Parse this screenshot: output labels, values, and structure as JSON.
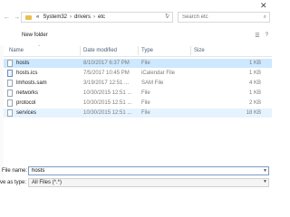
{
  "address": {
    "prefix": "«",
    "segments": [
      "System32",
      "drivers",
      "etc"
    ],
    "separator": "›"
  },
  "search": {
    "placeholder": "Search etc"
  },
  "toolbar": {
    "new_folder_label": "New folder"
  },
  "columns": {
    "name": "Name",
    "date": "Date modified",
    "type": "Type",
    "size": "Size"
  },
  "files": [
    {
      "name": "hosts",
      "date": "8/10/2017 6:37 PM",
      "type": "File",
      "size": "1 KB",
      "icon": "file-icon",
      "state": "selected"
    },
    {
      "name": "hosts.ics",
      "date": "7/5/2017 10:45 PM",
      "type": "iCalendar File",
      "size": "1 KB",
      "icon": "calendar-file-icon",
      "state": ""
    },
    {
      "name": "lmhosts.sam",
      "date": "3/19/2017 12:51 ...",
      "type": "SAM File",
      "size": "4 KB",
      "icon": "file-icon",
      "state": ""
    },
    {
      "name": "networks",
      "date": "10/30/2015 12:51 ...",
      "type": "File",
      "size": "1 KB",
      "icon": "file-icon",
      "state": ""
    },
    {
      "name": "protocol",
      "date": "10/30/2015 12:51 ...",
      "type": "File",
      "size": "2 KB",
      "icon": "file-icon",
      "state": ""
    },
    {
      "name": "services",
      "date": "10/30/2015 12:51 ...",
      "type": "File",
      "size": "18 KB",
      "icon": "file-icon",
      "state": "hover"
    }
  ],
  "filename": {
    "label": "File name:",
    "value": "hosts"
  },
  "filetype": {
    "label": "ve as type:",
    "value": "All Files (*.*)"
  },
  "colors": {
    "selected_row": "#cde8ff",
    "hover_row": "#e5f3ff",
    "header_text": "#4b5f73",
    "folder": "#e8c050"
  }
}
